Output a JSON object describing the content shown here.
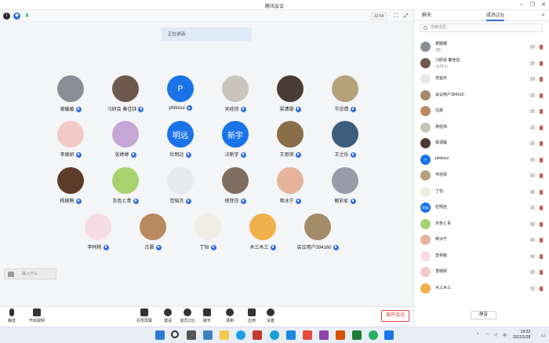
{
  "window": {
    "title": "腾讯会议"
  },
  "top": {
    "timer": "32:54"
  },
  "banner": {
    "speaking": "正在讲话:"
  },
  "participants_grid": [
    {
      "name": "谢媛媛",
      "color": "#8a8f96"
    },
    {
      "name": "习研会 秦佳钰",
      "color": "#6e5a4d"
    },
    {
      "name": "philocui",
      "color": "#1a73e8",
      "initial": "P"
    },
    {
      "name": "吴经炜",
      "color": "#c9c4bc"
    },
    {
      "name": "梁潇璇",
      "color": "#4a3b36"
    },
    {
      "name": "岑忠倩",
      "color": "#b4a27b"
    },
    {
      "name": "李婉妍",
      "color": "#f3c9c7"
    },
    {
      "name": "张婷婷",
      "color": "#c5a8d8"
    },
    {
      "name": "杜明远",
      "color": "#1a73e8",
      "initial": "明远"
    },
    {
      "name": "汪新宇",
      "color": "#1a73e8",
      "initial": "新宇"
    },
    {
      "name": "王思琪",
      "color": "#8a6e4a"
    },
    {
      "name": "王之乐",
      "color": "#3d5d7d"
    },
    {
      "name": "杨婉鹃",
      "color": "#5d3d2a"
    },
    {
      "name": "灰色と青",
      "color": "#a8d26e"
    },
    {
      "name": "范韬杰",
      "color": "#e7eaed"
    },
    {
      "name": "邢菲莎",
      "color": "#7e6e62"
    },
    {
      "name": "蒋冰宁",
      "color": "#e6b49d"
    },
    {
      "name": "鲍彩虹",
      "color": "#9a9aa8"
    },
    {
      "name": "李柯桃",
      "color": "#f6dde4"
    },
    {
      "name": "古晨",
      "color": "#b88a5e"
    },
    {
      "name": "丁怡",
      "color": "#f1ece4"
    },
    {
      "name": "木三木三",
      "color": "#f0b04a"
    },
    {
      "name": "会议用户394160",
      "color": "#a48b6a"
    }
  ],
  "chat_input": {
    "placeholder": "输入什么..."
  },
  "bottom": {
    "mute": "静音",
    "video": "开启视频",
    "share": "共享屏幕",
    "invite": "邀请",
    "members": "成员(23)",
    "chat": "聊天",
    "record": "录制",
    "apps": "应用",
    "settings": "设置",
    "leave": "离开会议"
  },
  "panel": {
    "tab_chat": "聊天",
    "tab_members": "成员(23)",
    "search_placeholder": "搜索成员",
    "mute_all": "静音",
    "members": [
      {
        "name": "谢媛媛",
        "role": "(我)",
        "color": "#8a8f96"
      },
      {
        "name": "习研会 秦佳钰",
        "role": "(主持人)",
        "color": "#6e5a4d"
      },
      {
        "name": "范韬杰",
        "role": "",
        "color": "#e7eaed"
      },
      {
        "name": "会议用户394160",
        "role": "",
        "color": "#a48b6a"
      },
      {
        "name": "古晨",
        "role": "",
        "color": "#b88a5e"
      },
      {
        "name": "吴经炜",
        "role": "",
        "color": "#c9c4bc"
      },
      {
        "name": "梁潇璇",
        "role": "",
        "color": "#4a3b36"
      },
      {
        "name": "philocui",
        "role": "",
        "color": "#1a73e8",
        "initial": "P"
      },
      {
        "name": "岑忠倩",
        "role": "",
        "color": "#b4a27b"
      },
      {
        "name": "丁怡",
        "role": "",
        "color": "#f1ece4"
      },
      {
        "name": "杜明远",
        "role": "",
        "color": "#1a73e8",
        "initial": "明远"
      },
      {
        "name": "灰色と青",
        "role": "",
        "color": "#a8d26e"
      },
      {
        "name": "蒋冰宁",
        "role": "",
        "color": "#e6b49d"
      },
      {
        "name": "李柯桃",
        "role": "",
        "color": "#f6dde4"
      },
      {
        "name": "李婉妍",
        "role": "",
        "color": "#f3c9c7"
      },
      {
        "name": "木三木三",
        "role": "",
        "color": "#f0b04a"
      }
    ]
  },
  "taskbar": {
    "clock_time": "19:33",
    "clock_date": "2022/1/28",
    "ime": "中"
  }
}
